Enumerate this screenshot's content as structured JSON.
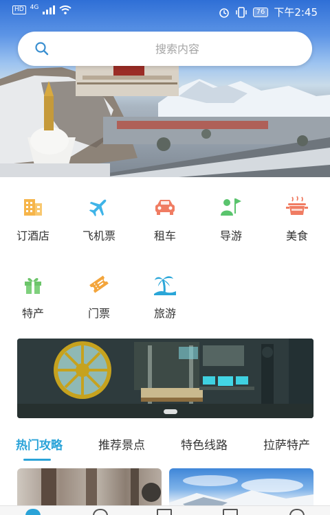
{
  "status_bar": {
    "network_badge": "HD",
    "network_type": "4G",
    "battery_level": "76",
    "time": "下午2:45"
  },
  "search": {
    "placeholder": "搜索内容"
  },
  "categories": [
    {
      "label": "订酒店",
      "icon": "hotel-icon",
      "color": "#f6b54a"
    },
    {
      "label": "飞机票",
      "icon": "airplane-icon",
      "color": "#3fb4e8"
    },
    {
      "label": "租车",
      "icon": "car-icon",
      "color": "#f07c62"
    },
    {
      "label": "导游",
      "icon": "guide-icon",
      "color": "#5ac46d"
    },
    {
      "label": "美食",
      "icon": "food-pot-icon",
      "color": "#f07c62"
    },
    {
      "label": "特产",
      "icon": "gift-icon",
      "color": "#6cc56a"
    },
    {
      "label": "门票",
      "icon": "ticket-icon",
      "color": "#f3a53c"
    },
    {
      "label": "旅游",
      "icon": "palm-island-icon",
      "color": "#2aa6d8"
    }
  ],
  "tabs": [
    {
      "label": "热门攻略",
      "active": true
    },
    {
      "label": "推荐景点",
      "active": false
    },
    {
      "label": "特色线路",
      "active": false
    },
    {
      "label": "拉萨特产",
      "active": false
    }
  ],
  "colors": {
    "accent": "#2aa3d8"
  }
}
